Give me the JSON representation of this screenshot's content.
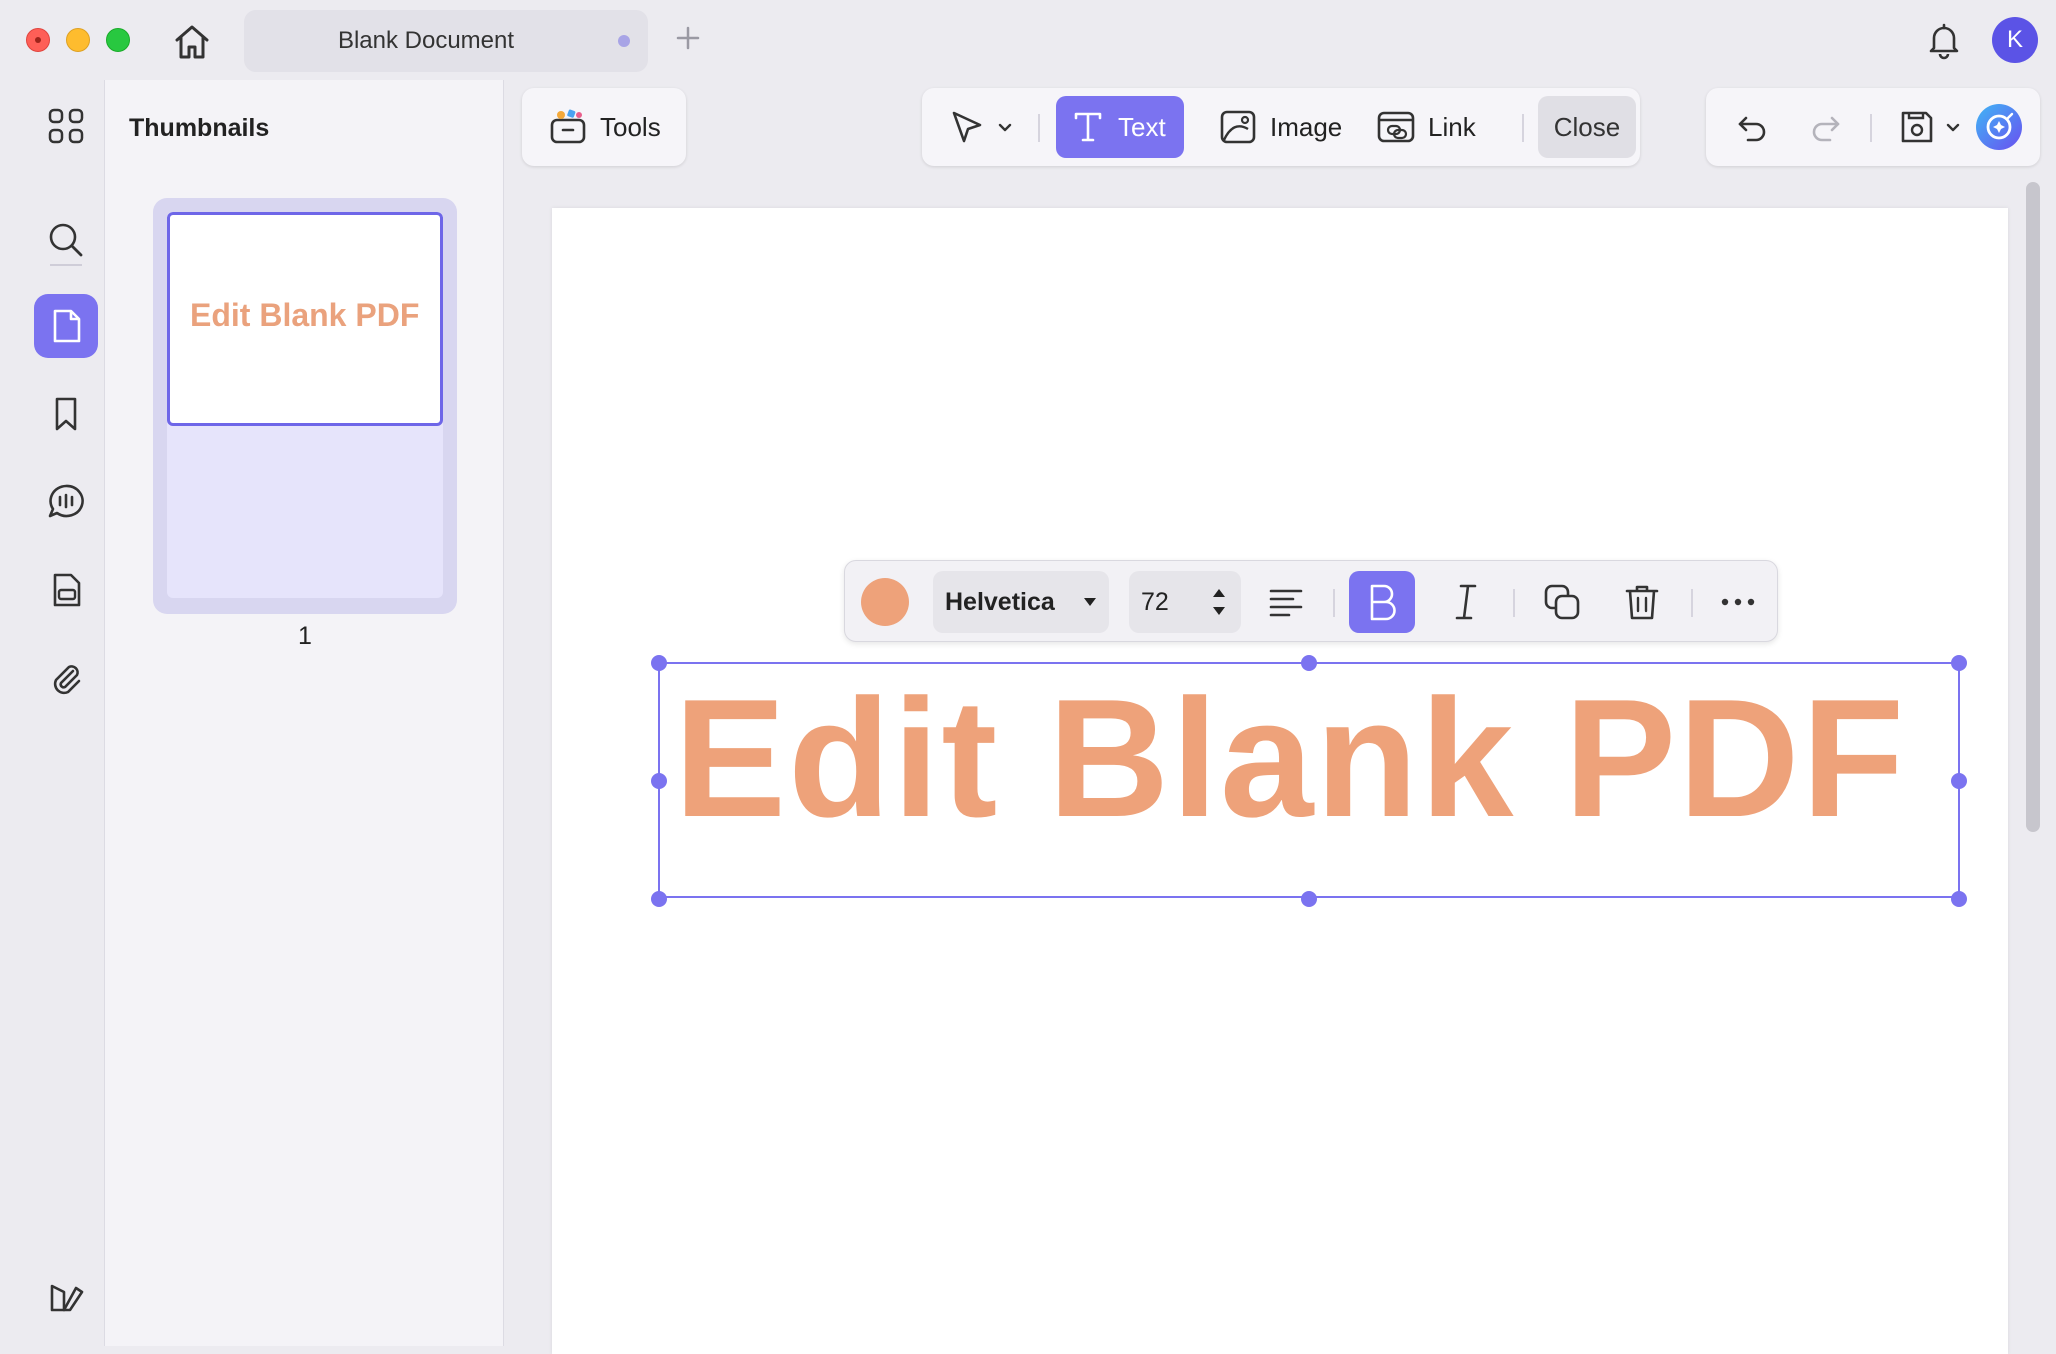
{
  "window": {
    "tab_title": "Blank Document",
    "avatar_initial": "K"
  },
  "thumbnails": {
    "title": "Thumbnails",
    "pages": [
      {
        "number": "1",
        "preview_text": "Edit Blank PDF"
      }
    ]
  },
  "toolbar": {
    "tools_label": "Tools",
    "text_label": "Text",
    "image_label": "Image",
    "link_label": "Link",
    "close_label": "Close"
  },
  "text_format": {
    "font": "Helvetica",
    "size": "72",
    "color": "#eea27a",
    "bold_active": true
  },
  "document": {
    "text_content": "Edit Blank PDF"
  },
  "colors": {
    "accent": "#7b73f0",
    "text_color": "#eea27a"
  }
}
